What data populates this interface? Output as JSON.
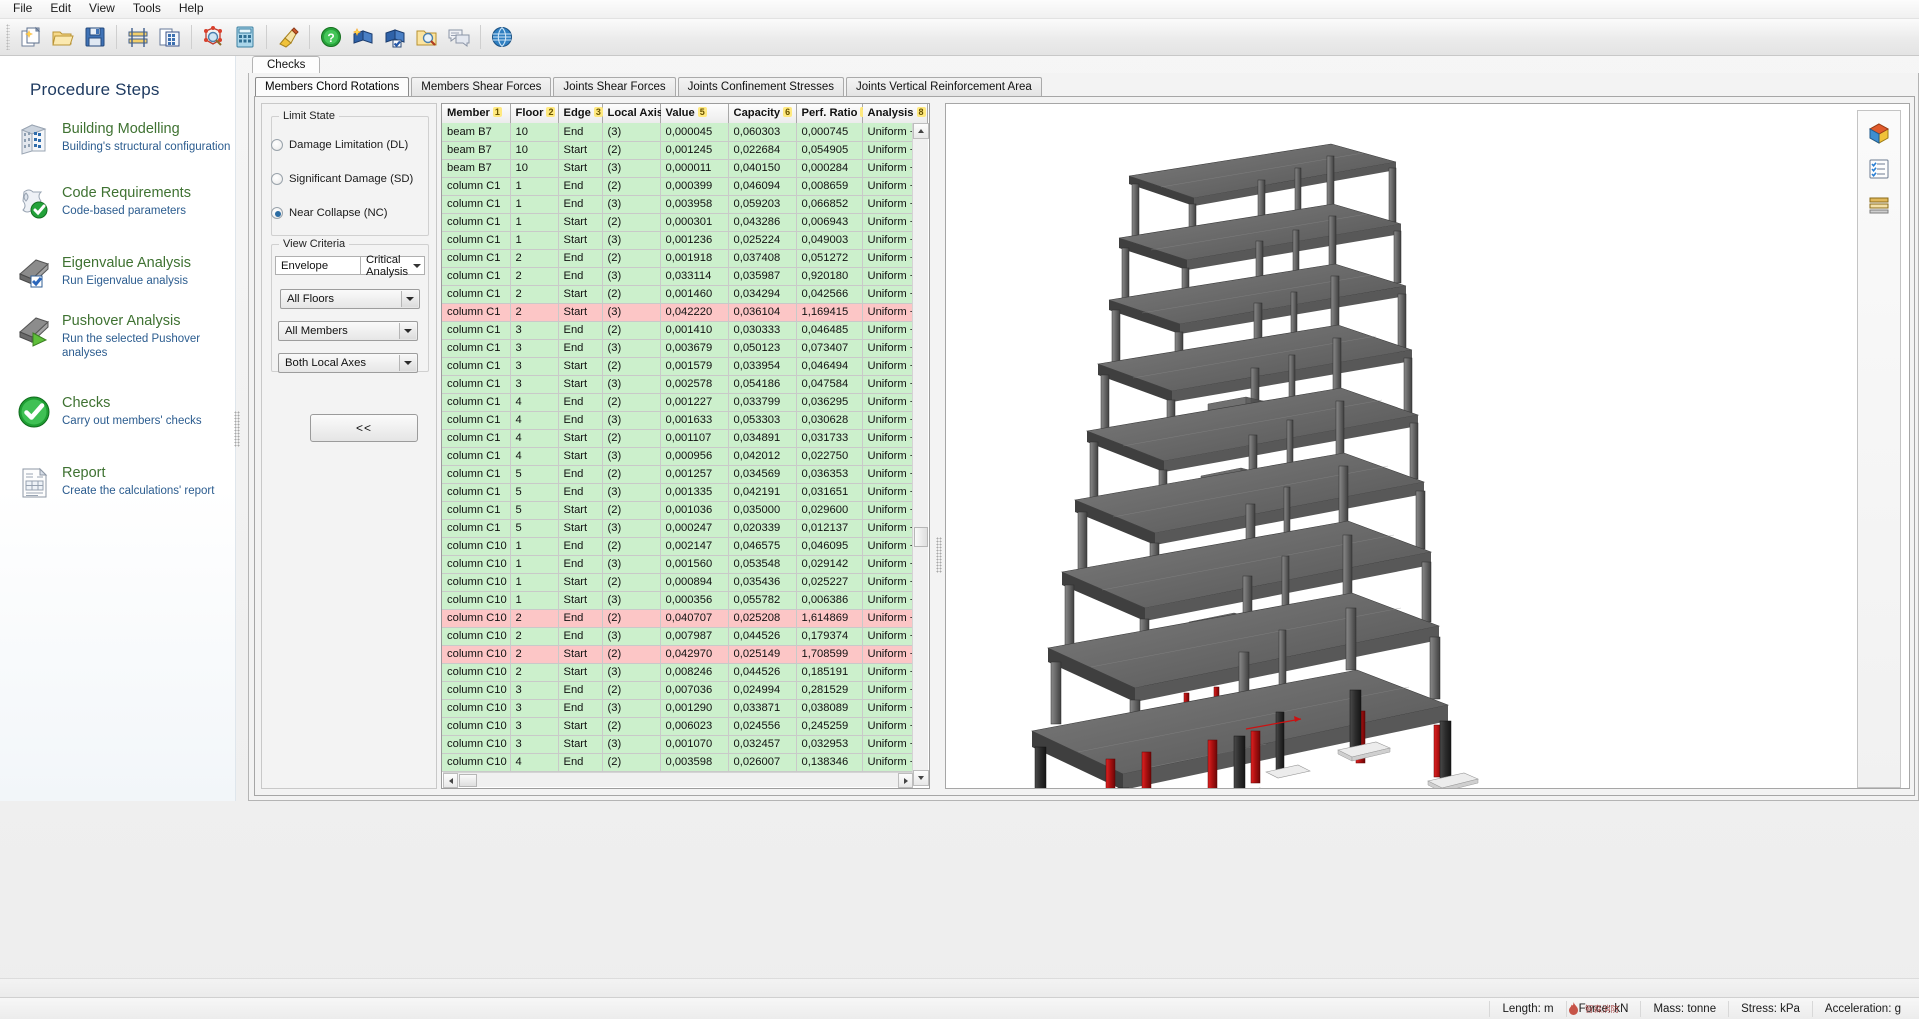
{
  "menubar": {
    "items": [
      {
        "label": "File"
      },
      {
        "label": "Edit"
      },
      {
        "label": "View"
      },
      {
        "label": "Tools"
      },
      {
        "label": "Help"
      }
    ]
  },
  "toolbar": {
    "buttons": [
      {
        "icon": "new-document-icon",
        "title": "New"
      },
      {
        "icon": "open-folder-icon",
        "title": "Open"
      },
      {
        "icon": "save-floppy-icon",
        "title": "Save"
      },
      {
        "icon": "beam-section-icon",
        "title": "Sections"
      },
      {
        "icon": "building-copy-icon",
        "title": "Building"
      },
      {
        "icon": "molecule-search-icon",
        "title": "Model Inspect"
      },
      {
        "icon": "calculator-icon",
        "title": "Calculator"
      },
      {
        "icon": "paintbrush-icon",
        "title": "Appearance"
      },
      {
        "icon": "help-question-icon",
        "title": "Help"
      },
      {
        "icon": "book-new-icon",
        "title": "Manual"
      },
      {
        "icon": "book-check-icon",
        "title": "Verification"
      },
      {
        "icon": "folder-search-icon",
        "title": "Examples"
      },
      {
        "icon": "chat-bubbles-icon",
        "title": "Support"
      },
      {
        "icon": "globe-icon",
        "title": "Web"
      }
    ]
  },
  "sidebar": {
    "title": "Procedure Steps",
    "items": [
      {
        "name": "Building Modelling",
        "desc": "Building's structural configuration",
        "icon": "building-icon"
      },
      {
        "name": "Code Requirements",
        "desc": "Code-based parameters",
        "icon": "scroll-check-icon"
      },
      {
        "name": "Eigenvalue Analysis",
        "desc": "Run Eigenvalue analysis",
        "icon": "analysis-check-icon"
      },
      {
        "name": "Pushover Analysis",
        "desc": "Run the selected Pushover analyses",
        "icon": "analysis-play-icon"
      },
      {
        "name": "Checks",
        "desc": "Carry out members' checks",
        "icon": "green-check-icon"
      },
      {
        "name": "Report",
        "desc": "Create the calculations' report",
        "icon": "report-document-icon"
      }
    ]
  },
  "main": {
    "outer_tab": "Checks",
    "sub_tabs": [
      {
        "label": "Members Chord Rotations",
        "active": true
      },
      {
        "label": "Members Shear Forces",
        "active": false
      },
      {
        "label": "Joints Shear Forces",
        "active": false
      },
      {
        "label": "Joints Confinement Stresses",
        "active": false
      },
      {
        "label": "Joints Vertical Reinforcement Area",
        "active": false
      }
    ]
  },
  "criteria": {
    "limit_state_legend": "Limit State",
    "limit_states": [
      {
        "label": "Damage Limitation (DL)",
        "selected": false
      },
      {
        "label": "Significant Damage (SD)",
        "selected": false
      },
      {
        "label": "Near Collapse (NC)",
        "selected": true
      }
    ],
    "view_criteria_legend": "View Criteria",
    "envelope_label": "Envelope",
    "envelope_value": "Critical Analysis",
    "filters": [
      {
        "name": "floors-filter",
        "value": "All Floors"
      },
      {
        "name": "members-filter",
        "value": "All Members"
      },
      {
        "name": "axes-filter",
        "value": "Both Local Axes"
      }
    ],
    "back_button": "<<"
  },
  "table": {
    "columns": [
      {
        "label": "Member",
        "sort": "1"
      },
      {
        "label": "Floor",
        "sort": "2"
      },
      {
        "label": "Edge",
        "sort": "3"
      },
      {
        "label": "Local Axis",
        "sort": "4"
      },
      {
        "label": "Value",
        "sort": "5"
      },
      {
        "label": "Capacity",
        "sort": "6"
      },
      {
        "label": "Perf. Ratio",
        "sort": "7"
      },
      {
        "label": "Analysis",
        "sort": "8"
      }
    ],
    "rows": [
      {
        "member": "beam B7",
        "floor": "10",
        "edge": "End",
        "axis": "(3)",
        "value": "0,000045",
        "capacity": "0,060303",
        "ratio": "0,000745",
        "analysis": "Uniform +X",
        "status": "ok"
      },
      {
        "member": "beam B7",
        "floor": "10",
        "edge": "Start",
        "axis": "(2)",
        "value": "0,001245",
        "capacity": "0,022684",
        "ratio": "0,054905",
        "analysis": "Uniform +X",
        "status": "ok"
      },
      {
        "member": "beam B7",
        "floor": "10",
        "edge": "Start",
        "axis": "(3)",
        "value": "0,000011",
        "capacity": "0,040150",
        "ratio": "0,000284",
        "analysis": "Uniform +X",
        "status": "ok"
      },
      {
        "member": "column C1",
        "floor": "1",
        "edge": "End",
        "axis": "(2)",
        "value": "0,000399",
        "capacity": "0,046094",
        "ratio": "0,008659",
        "analysis": "Uniform +X",
        "status": "ok"
      },
      {
        "member": "column C1",
        "floor": "1",
        "edge": "End",
        "axis": "(3)",
        "value": "0,003958",
        "capacity": "0,059203",
        "ratio": "0,066852",
        "analysis": "Uniform +X",
        "status": "ok"
      },
      {
        "member": "column C1",
        "floor": "1",
        "edge": "Start",
        "axis": "(2)",
        "value": "0,000301",
        "capacity": "0,043286",
        "ratio": "0,006943",
        "analysis": "Uniform +X",
        "status": "ok"
      },
      {
        "member": "column C1",
        "floor": "1",
        "edge": "Start",
        "axis": "(3)",
        "value": "0,001236",
        "capacity": "0,025224",
        "ratio": "0,049003",
        "analysis": "Uniform +X",
        "status": "ok"
      },
      {
        "member": "column C1",
        "floor": "2",
        "edge": "End",
        "axis": "(2)",
        "value": "0,001918",
        "capacity": "0,037408",
        "ratio": "0,051272",
        "analysis": "Uniform +X",
        "status": "ok"
      },
      {
        "member": "column C1",
        "floor": "2",
        "edge": "End",
        "axis": "(3)",
        "value": "0,033114",
        "capacity": "0,035987",
        "ratio": "0,920180",
        "analysis": "Uniform +X",
        "status": "ok"
      },
      {
        "member": "column C1",
        "floor": "2",
        "edge": "Start",
        "axis": "(2)",
        "value": "0,001460",
        "capacity": "0,034294",
        "ratio": "0,042566",
        "analysis": "Uniform +X",
        "status": "ok"
      },
      {
        "member": "column C1",
        "floor": "2",
        "edge": "Start",
        "axis": "(3)",
        "value": "0,042220",
        "capacity": "0,036104",
        "ratio": "1,169415",
        "analysis": "Uniform +X",
        "status": "bad"
      },
      {
        "member": "column C1",
        "floor": "3",
        "edge": "End",
        "axis": "(2)",
        "value": "0,001410",
        "capacity": "0,030333",
        "ratio": "0,046485",
        "analysis": "Uniform +X",
        "status": "ok"
      },
      {
        "member": "column C1",
        "floor": "3",
        "edge": "End",
        "axis": "(3)",
        "value": "0,003679",
        "capacity": "0,050123",
        "ratio": "0,073407",
        "analysis": "Uniform +X",
        "status": "ok"
      },
      {
        "member": "column C1",
        "floor": "3",
        "edge": "Start",
        "axis": "(2)",
        "value": "0,001579",
        "capacity": "0,033954",
        "ratio": "0,046494",
        "analysis": "Uniform +X",
        "status": "ok"
      },
      {
        "member": "column C1",
        "floor": "3",
        "edge": "Start",
        "axis": "(3)",
        "value": "0,002578",
        "capacity": "0,054186",
        "ratio": "0,047584",
        "analysis": "Uniform +X",
        "status": "ok"
      },
      {
        "member": "column C1",
        "floor": "4",
        "edge": "End",
        "axis": "(2)",
        "value": "0,001227",
        "capacity": "0,033799",
        "ratio": "0,036295",
        "analysis": "Uniform +X",
        "status": "ok"
      },
      {
        "member": "column C1",
        "floor": "4",
        "edge": "End",
        "axis": "(3)",
        "value": "0,001633",
        "capacity": "0,053303",
        "ratio": "0,030628",
        "analysis": "Uniform +X",
        "status": "ok"
      },
      {
        "member": "column C1",
        "floor": "4",
        "edge": "Start",
        "axis": "(2)",
        "value": "0,001107",
        "capacity": "0,034891",
        "ratio": "0,031733",
        "analysis": "Uniform +X",
        "status": "ok"
      },
      {
        "member": "column C1",
        "floor": "4",
        "edge": "Start",
        "axis": "(3)",
        "value": "0,000956",
        "capacity": "0,042012",
        "ratio": "0,022750",
        "analysis": "Uniform +X",
        "status": "ok"
      },
      {
        "member": "column C1",
        "floor": "5",
        "edge": "End",
        "axis": "(2)",
        "value": "0,001257",
        "capacity": "0,034569",
        "ratio": "0,036353",
        "analysis": "Uniform +X",
        "status": "ok"
      },
      {
        "member": "column C1",
        "floor": "5",
        "edge": "End",
        "axis": "(3)",
        "value": "0,001335",
        "capacity": "0,042191",
        "ratio": "0,031651",
        "analysis": "Uniform +X",
        "status": "ok"
      },
      {
        "member": "column C1",
        "floor": "5",
        "edge": "Start",
        "axis": "(2)",
        "value": "0,001036",
        "capacity": "0,035000",
        "ratio": "0,029600",
        "analysis": "Uniform +X",
        "status": "ok"
      },
      {
        "member": "column C1",
        "floor": "5",
        "edge": "Start",
        "axis": "(3)",
        "value": "0,000247",
        "capacity": "0,020339",
        "ratio": "0,012137",
        "analysis": "Uniform +X",
        "status": "ok"
      },
      {
        "member": "column C10",
        "floor": "1",
        "edge": "End",
        "axis": "(2)",
        "value": "0,002147",
        "capacity": "0,046575",
        "ratio": "0,046095",
        "analysis": "Uniform +X",
        "status": "ok"
      },
      {
        "member": "column C10",
        "floor": "1",
        "edge": "End",
        "axis": "(3)",
        "value": "0,001560",
        "capacity": "0,053548",
        "ratio": "0,029142",
        "analysis": "Uniform +X",
        "status": "ok"
      },
      {
        "member": "column C10",
        "floor": "1",
        "edge": "Start",
        "axis": "(2)",
        "value": "0,000894",
        "capacity": "0,035436",
        "ratio": "0,025227",
        "analysis": "Uniform +X",
        "status": "ok"
      },
      {
        "member": "column C10",
        "floor": "1",
        "edge": "Start",
        "axis": "(3)",
        "value": "0,000356",
        "capacity": "0,055782",
        "ratio": "0,006386",
        "analysis": "Uniform +X",
        "status": "ok"
      },
      {
        "member": "column C10",
        "floor": "2",
        "edge": "End",
        "axis": "(2)",
        "value": "0,040707",
        "capacity": "0,025208",
        "ratio": "1,614869",
        "analysis": "Uniform +X",
        "status": "bad"
      },
      {
        "member": "column C10",
        "floor": "2",
        "edge": "End",
        "axis": "(3)",
        "value": "0,007987",
        "capacity": "0,044526",
        "ratio": "0,179374",
        "analysis": "Uniform +X",
        "status": "ok"
      },
      {
        "member": "column C10",
        "floor": "2",
        "edge": "Start",
        "axis": "(2)",
        "value": "0,042970",
        "capacity": "0,025149",
        "ratio": "1,708599",
        "analysis": "Uniform +X",
        "status": "bad"
      },
      {
        "member": "column C10",
        "floor": "2",
        "edge": "Start",
        "axis": "(3)",
        "value": "0,008246",
        "capacity": "0,044526",
        "ratio": "0,185191",
        "analysis": "Uniform +X",
        "status": "ok"
      },
      {
        "member": "column C10",
        "floor": "3",
        "edge": "End",
        "axis": "(2)",
        "value": "0,007036",
        "capacity": "0,024994",
        "ratio": "0,281529",
        "analysis": "Uniform +X",
        "status": "ok"
      },
      {
        "member": "column C10",
        "floor": "3",
        "edge": "End",
        "axis": "(3)",
        "value": "0,001290",
        "capacity": "0,033871",
        "ratio": "0,038089",
        "analysis": "Uniform +X",
        "status": "ok"
      },
      {
        "member": "column C10",
        "floor": "3",
        "edge": "Start",
        "axis": "(2)",
        "value": "0,006023",
        "capacity": "0,024556",
        "ratio": "0,245259",
        "analysis": "Uniform +X",
        "status": "ok"
      },
      {
        "member": "column C10",
        "floor": "3",
        "edge": "Start",
        "axis": "(3)",
        "value": "0,001070",
        "capacity": "0,032457",
        "ratio": "0,032953",
        "analysis": "Uniform +X",
        "status": "ok"
      },
      {
        "member": "column C10",
        "floor": "4",
        "edge": "End",
        "axis": "(2)",
        "value": "0,003598",
        "capacity": "0,026007",
        "ratio": "0,138346",
        "analysis": "Uniform +X",
        "status": "ok"
      }
    ]
  },
  "viewport": {
    "tools": [
      {
        "icon": "render-colors-icon",
        "name": "render-mode-button"
      },
      {
        "icon": "checklist-icon",
        "name": "results-display-button"
      },
      {
        "icon": "layers-icon",
        "name": "layers-button"
      }
    ]
  },
  "statusbar": {
    "cells": [
      {
        "label": "Length: m"
      },
      {
        "label": "Force: kN"
      },
      {
        "label": "Mass: tonne"
      },
      {
        "label": "Stress: kPa"
      },
      {
        "label": "Acceleration: g"
      }
    ],
    "watermark": "智森消防"
  }
}
